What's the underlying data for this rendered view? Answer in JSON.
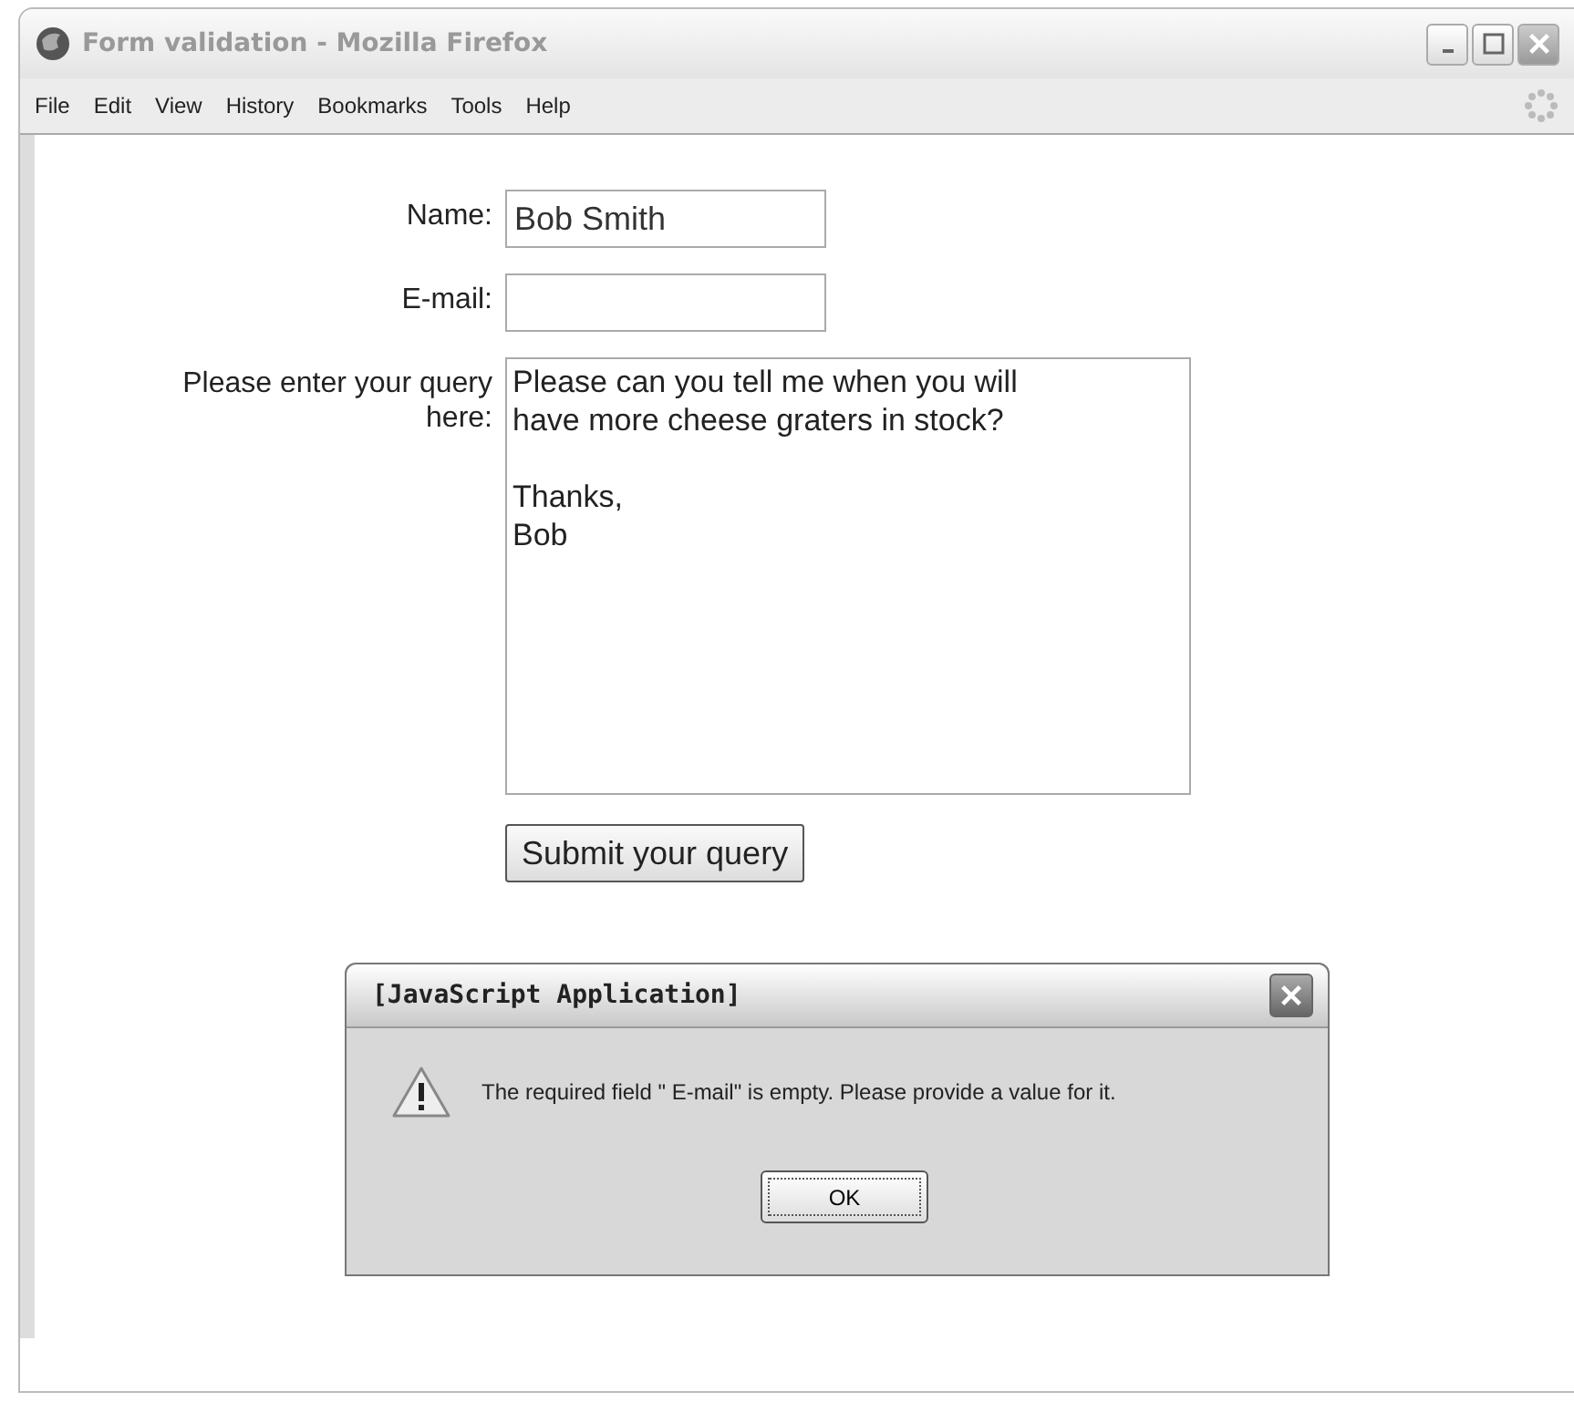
{
  "window": {
    "title": "Form validation - Mozilla Firefox"
  },
  "menu": [
    "File",
    "Edit",
    "View",
    "History",
    "Bookmarks",
    "Tools",
    "Help"
  ],
  "form": {
    "fields": [
      {
        "kind": "text",
        "label": "Name:",
        "value": "Bob Smith"
      },
      {
        "kind": "text",
        "label": "E-mail:"
      },
      {
        "kind": "textarea",
        "label": "Please enter your query here:",
        "value": "Please can you tell me when you will\nhave more cheese graters in stock?\n\nThanks,\nBob"
      }
    ],
    "submit": "Submit your query"
  },
  "dialog": {
    "title": "[JavaScript Application]",
    "message": "The required field \" E-mail\" is empty. Please provide a value for it.",
    "button": "OK"
  }
}
